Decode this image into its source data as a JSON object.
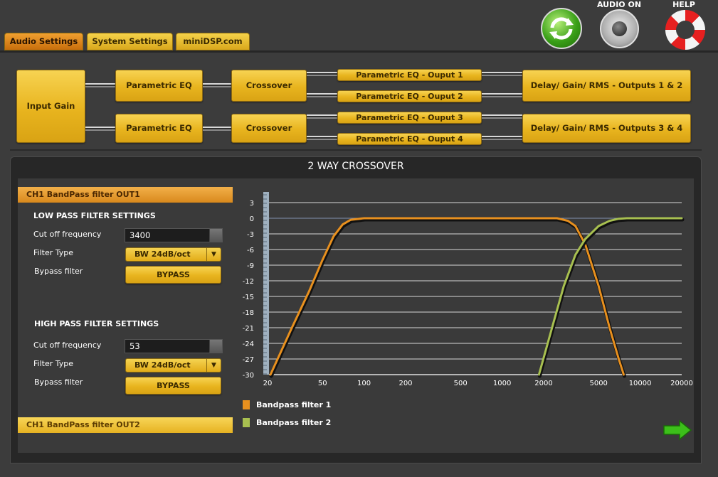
{
  "tabs": [
    {
      "label": "Audio Settings",
      "active": true
    },
    {
      "label": "System Settings",
      "active": false
    },
    {
      "label": "miniDSP.com",
      "active": false
    }
  ],
  "header_icons": {
    "audio_on": "AUDIO ON",
    "help": "HELP"
  },
  "routing": {
    "input_gain": "Input Gain",
    "peq": [
      "Parametric EQ",
      "Parametric EQ"
    ],
    "crossover": [
      "Crossover",
      "Crossover"
    ],
    "outputs_peq": [
      "Parametric EQ - Ouput 1",
      "Parametric EQ - Ouput 2",
      "Parametric EQ - Ouput 3",
      "Parametric EQ - Ouput 4"
    ],
    "delay": [
      "Delay/ Gain/ RMS - Outputs 1 & 2",
      "Delay/ Gain/ RMS - Outputs 3 & 4"
    ]
  },
  "panel": {
    "title": "2 WAY CROSSOVER",
    "ch_out1": "CH1 BandPass filter OUT1",
    "ch_out2": "CH1 BandPass filter OUT2",
    "low_pass": {
      "heading": "LOW PASS FILTER SETTINGS",
      "cutoff_label": "Cut off frequency",
      "cutoff_value": "3400",
      "type_label": "Filter Type",
      "type_value": "BW 24dB/oct",
      "bypass_label": "Bypass filter",
      "bypass_button": "BYPASS"
    },
    "high_pass": {
      "heading": "HIGH PASS FILTER SETTINGS",
      "cutoff_label": "Cut off frequency",
      "cutoff_value": "53",
      "type_label": "Filter Type",
      "type_value": "BW 24dB/oct",
      "bypass_label": "Bypass filter",
      "bypass_button": "BYPASS"
    }
  },
  "colors": {
    "series1": "#e8901e",
    "series2": "#a8c050",
    "accent": "#f0c030"
  },
  "chart_data": {
    "type": "line",
    "x_scale": "log",
    "xlim": [
      20,
      20000
    ],
    "ylim": [
      -30,
      3
    ],
    "x_ticks": [
      20,
      50,
      100,
      200,
      500,
      1000,
      2000,
      5000,
      10000,
      20000
    ],
    "y_ticks": [
      3,
      0,
      -3,
      -6,
      -9,
      -12,
      -15,
      -18,
      -21,
      -24,
      -27,
      -30
    ],
    "grid": true,
    "series": [
      {
        "name": "Bandpass filter 1",
        "color": "#e8901e",
        "x": [
          21,
          30,
          40,
          50,
          60,
          70,
          80,
          100,
          2500,
          3000,
          3400,
          4000,
          5000,
          6000,
          7000,
          7600
        ],
        "y": [
          -30,
          -21,
          -14,
          -8,
          -3.5,
          -1.2,
          -0.3,
          0,
          0,
          -0.5,
          -1.5,
          -5,
          -13,
          -21,
          -27,
          -30
        ]
      },
      {
        "name": "Bandpass filter 2",
        "color": "#a8c050",
        "x": [
          1850,
          2300,
          2800,
          3400,
          4000,
          5000,
          6000,
          7000,
          8000,
          10000,
          20000
        ],
        "y": [
          -30,
          -21,
          -13,
          -7,
          -4,
          -1.5,
          -0.5,
          -0.1,
          0,
          0,
          0
        ]
      }
    ]
  }
}
